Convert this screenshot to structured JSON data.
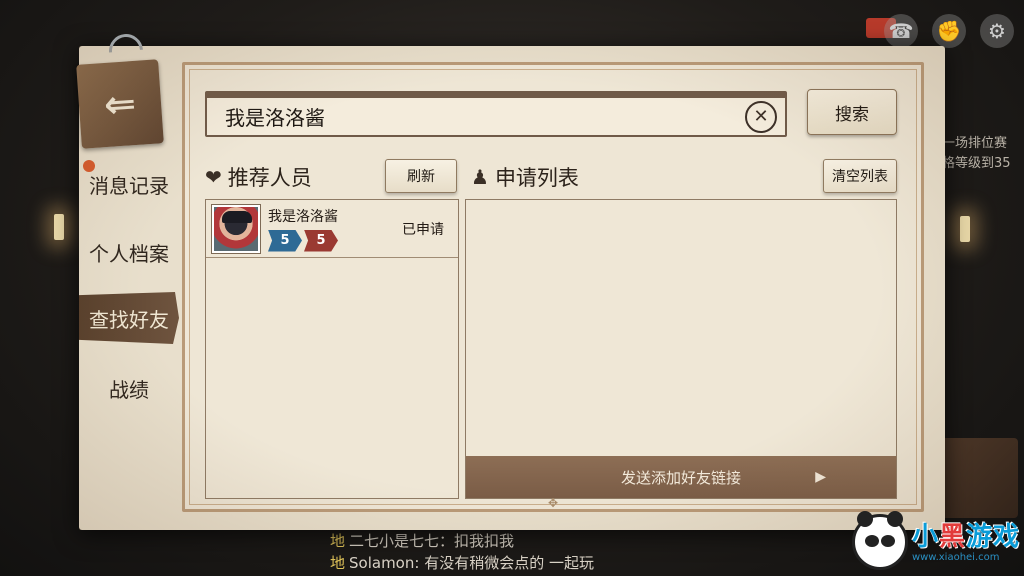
{
  "background": {
    "right_text_lines": [
      "一场排位赛",
      "格等级到35"
    ],
    "chat": [
      {
        "channel": "地",
        "text": "二七小是七七：扣我扣我"
      },
      {
        "channel": "地",
        "text": "Solamon: 有没有稍微会点的 一起玩"
      }
    ],
    "icons": [
      "phone-icon",
      "fist-icon",
      "gear-icon"
    ]
  },
  "dialog": {
    "exit_icon": "exit-door-icon",
    "nav": [
      {
        "label": "消息记录",
        "has_dot": true,
        "active": false
      },
      {
        "label": "个人档案",
        "has_dot": false,
        "active": false
      },
      {
        "label": "查找好友",
        "has_dot": false,
        "active": true
      },
      {
        "label": "战绩",
        "has_dot": false,
        "active": false
      }
    ],
    "search": {
      "value": "我是洛洛酱",
      "clear_icon": "close-circle-icon",
      "button_label": "搜索"
    },
    "recommend": {
      "title": "推荐人员",
      "icon": "heart-icon",
      "refresh_label": "刷新",
      "people": [
        {
          "name": "我是洛洛酱",
          "level_a": "5",
          "level_b": "5",
          "status": "已申请"
        }
      ]
    },
    "requests": {
      "title": "申请列表",
      "icon": "person-list-icon",
      "clear_label": "清空列表",
      "send_link_label": "发送添加好友链接"
    }
  },
  "watermark": {
    "brand_a": "小",
    "brand_b": "黑",
    "brand_c": "游戏",
    "url": "www.xiaohei.com"
  }
}
